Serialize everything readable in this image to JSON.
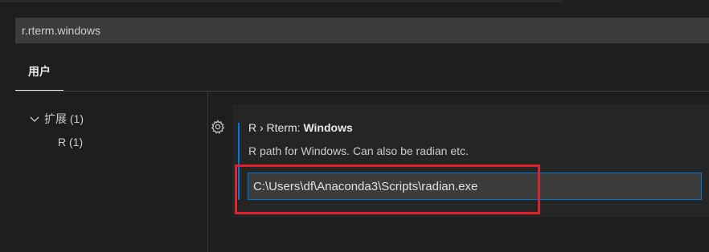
{
  "search": {
    "value": "r.rterm.windows"
  },
  "scope_tabs": {
    "user_label": "用户"
  },
  "toc": {
    "extensions_label": "扩展 (1)",
    "r_label": "R (1)"
  },
  "setting": {
    "category": "R › Rterm: ",
    "name": "Windows",
    "description": "R path for Windows. Can also be radian etc.",
    "value": "C:\\Users\\df\\Anaconda3\\Scripts\\radian.exe"
  },
  "icons": {
    "toc_expand": "chevron-down-icon",
    "setting_menu": "gear-icon"
  },
  "colors": {
    "focus_accent": "#007acc",
    "annotation_red": "#e0202a"
  }
}
